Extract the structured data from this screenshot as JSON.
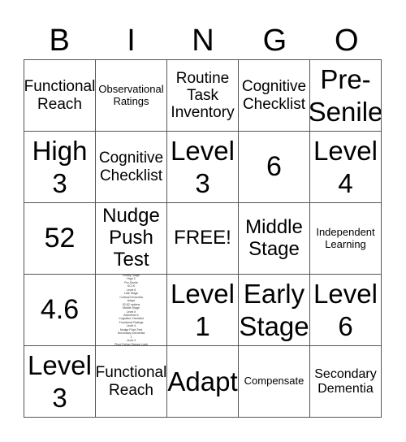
{
  "header": {
    "letters": [
      "B",
      "I",
      "N",
      "G",
      "O"
    ]
  },
  "cells": [
    [
      "Functional Reach",
      "Observational Ratings",
      "Routine Task Inventory",
      "Cognitive Checklist",
      "Pre-Senile"
    ],
    [
      "High 3",
      "Cognitive Checklist",
      "Level 3",
      "6",
      "Level 4"
    ],
    [
      "52",
      "Nudge Push Test",
      "FREE!",
      "Middle Stage",
      "Independent Learning"
    ],
    [
      "",
      "Level 1",
      "Early Stage",
      "Level 6",
      ""
    ],
    [
      "Level 3",
      "Functional Reach",
      "Adapt",
      "Compensate",
      "Secondary Dementia"
    ]
  ],
  "row4": {
    "col0": "4.6",
    "col2": "Level 1",
    "col3": "Early Stage",
    "col4": "Level 6"
  },
  "tiny_cell_lines": [
    "Pillarly Stage",
    "High 3",
    "Pre-Senile",
    "SCLS",
    "Level 6",
    "Late Stage",
    "Cortical Dementia",
    "Adapt",
    "52.62 options",
    "Middle Stage",
    "Level 5",
    "Alzheimer's",
    "Cognitive Checklist",
    "Functional Ratings",
    "Level 4",
    "Nudge Push Test",
    "Secondary Dementia",
    "1",
    "Level 2",
    "Pivot Follow Stream Light"
  ]
}
